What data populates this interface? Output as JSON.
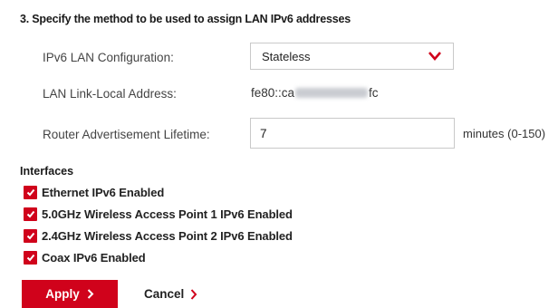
{
  "section": {
    "title": "3. Specify the method to be used to assign LAN IPv6 addresses"
  },
  "rows": {
    "ipv6_config_label": "IPv6 LAN Configuration:",
    "ipv6_config_value": "Stateless",
    "link_local_label": "LAN Link-Local Address:",
    "link_local_prefix": "fe80::ca",
    "link_local_suffix": "fc",
    "ra_lifetime_label": "Router Advertisement Lifetime:",
    "ra_lifetime_value": "7",
    "ra_lifetime_unit": "minutes (0-150)"
  },
  "interfaces": {
    "title": "Interfaces",
    "items": [
      {
        "label": "Ethernet IPv6 Enabled",
        "checked": true
      },
      {
        "label": "5.0GHz Wireless Access Point 1 IPv6 Enabled",
        "checked": true
      },
      {
        "label": "2.4GHz Wireless Access Point 2 IPv6 Enabled",
        "checked": true
      },
      {
        "label": "Coax IPv6 Enabled",
        "checked": true
      }
    ]
  },
  "actions": {
    "apply_label": "Apply",
    "cancel_label": "Cancel"
  },
  "colors": {
    "accent": "#d0021b",
    "text": "#2b2b2b",
    "border": "#c9c9c9"
  },
  "icons": {
    "dropdown": "chevron-down-icon",
    "checkbox": "checkmark-icon",
    "apply": "chevron-right-icon",
    "cancel": "chevron-right-icon"
  }
}
